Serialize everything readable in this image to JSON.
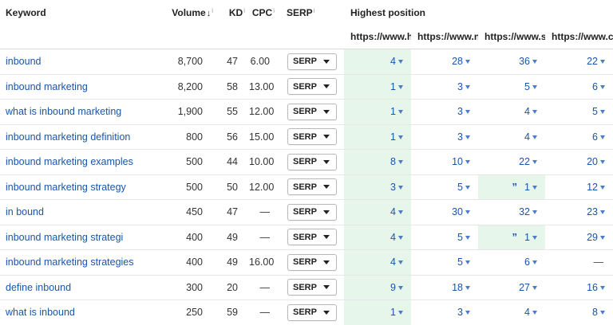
{
  "headers": {
    "keyword": "Keyword",
    "volume": "Volume",
    "kd": "KD",
    "cpc": "CPC",
    "serp": "SERP",
    "highest_position": "Highest position",
    "info_mark": "i"
  },
  "urls": [
    "https://www.h",
    "https://www.n",
    "https://www.s",
    "https://www.c"
  ],
  "serp_button_label": "SERP",
  "rows": [
    {
      "keyword": "inbound",
      "volume": "8,700",
      "kd": "47",
      "cpc": "6.00",
      "positions": [
        "4",
        "28",
        "36",
        "22"
      ]
    },
    {
      "keyword": "inbound marketing",
      "volume": "8,200",
      "kd": "58",
      "cpc": "13.00",
      "positions": [
        "1",
        "3",
        "5",
        "6"
      ]
    },
    {
      "keyword": "what is inbound marketing",
      "volume": "1,900",
      "kd": "55",
      "cpc": "12.00",
      "positions": [
        "1",
        "3",
        "4",
        "5"
      ]
    },
    {
      "keyword": "inbound marketing definition",
      "volume": "800",
      "kd": "56",
      "cpc": "15.00",
      "positions": [
        "1",
        "3",
        "4",
        "6"
      ]
    },
    {
      "keyword": "inbound marketing examples",
      "volume": "500",
      "kd": "44",
      "cpc": "10.00",
      "positions": [
        "8",
        "10",
        "22",
        "20"
      ]
    },
    {
      "keyword": "inbound marketing strategy",
      "volume": "500",
      "kd": "50",
      "cpc": "12.00",
      "positions": [
        "3",
        "5",
        "1",
        "12"
      ]
    },
    {
      "keyword": "in bound",
      "volume": "450",
      "kd": "47",
      "cpc": "—",
      "positions": [
        "4",
        "30",
        "32",
        "23"
      ]
    },
    {
      "keyword": "inbound marketing strategi",
      "volume": "400",
      "kd": "49",
      "cpc": "—",
      "positions": [
        "4",
        "5",
        "1",
        "29"
      ]
    },
    {
      "keyword": "inbound marketing strategies",
      "volume": "400",
      "kd": "49",
      "cpc": "16.00",
      "positions": [
        "4",
        "5",
        "6",
        "—"
      ]
    },
    {
      "keyword": "define inbound",
      "volume": "300",
      "kd": "20",
      "cpc": "—",
      "positions": [
        "9",
        "18",
        "27",
        "16"
      ]
    },
    {
      "keyword": "what is inbound",
      "volume": "250",
      "kd": "59",
      "cpc": "—",
      "positions": [
        "1",
        "3",
        "4",
        "8"
      ]
    }
  ],
  "colors": {
    "link": "#1a55a8",
    "highlight": "#e6f6ea"
  }
}
